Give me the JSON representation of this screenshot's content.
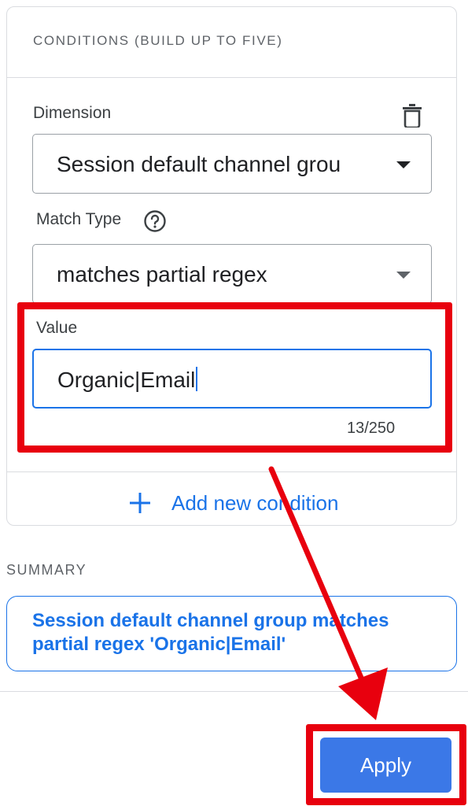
{
  "conditions": {
    "header": "CONDITIONS (BUILD UP TO FIVE)",
    "dimension": {
      "label": "Dimension",
      "selected": "Session default channel grou"
    },
    "match_type": {
      "label": "Match Type",
      "selected": "matches partial regex"
    },
    "value": {
      "label": "Value",
      "input_value": "Organic|Email",
      "counter": "13/250"
    },
    "add_condition_label": "Add new condition"
  },
  "summary": {
    "title": "SUMMARY",
    "text": "Session default channel group matches partial regex 'Organic|Email'"
  },
  "footer": {
    "apply_label": "Apply"
  },
  "colors": {
    "accent": "#1a73e8",
    "button": "#3b78e7",
    "annotation": "#e8000e"
  },
  "icons": [
    "trash-icon",
    "help-icon",
    "plus-icon",
    "dropdown-caret-icon"
  ]
}
